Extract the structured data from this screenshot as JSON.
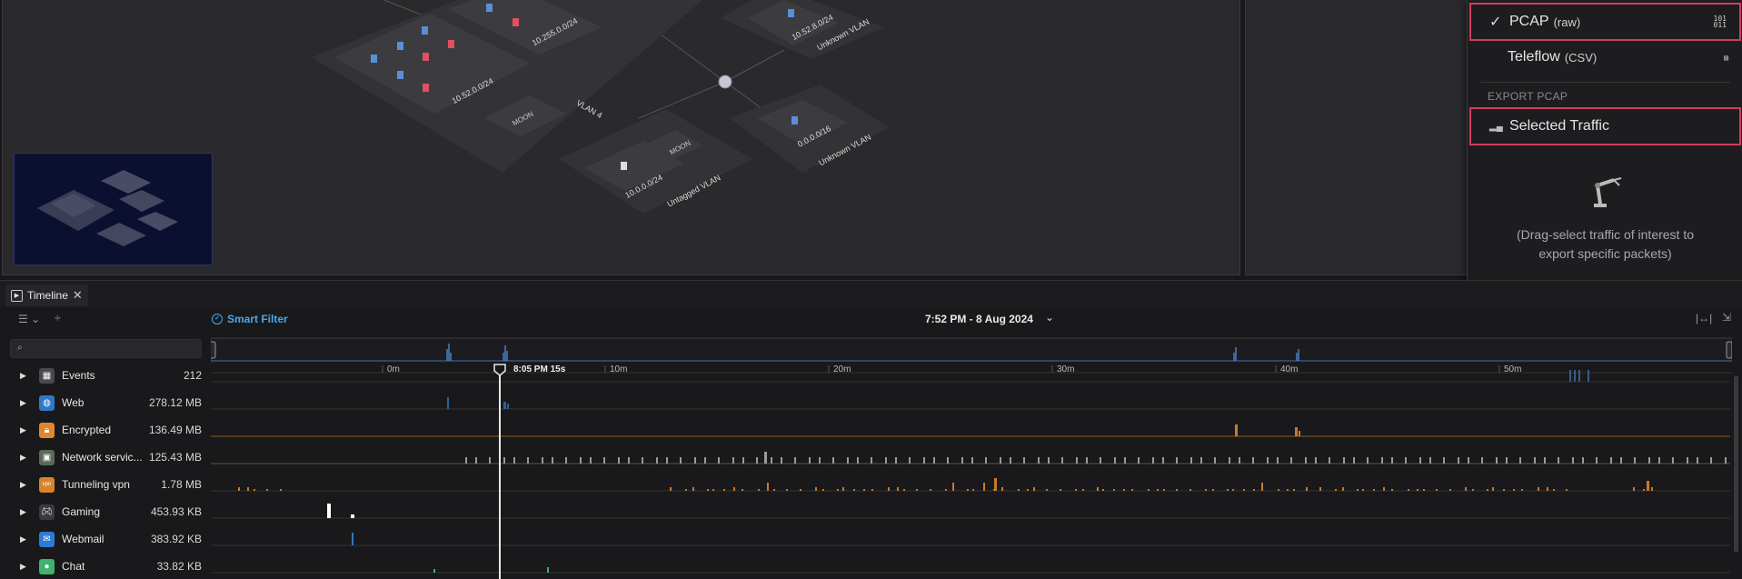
{
  "map": {
    "subnets": [
      "10.52.0.0/24",
      "10.255.0.0/24",
      "10.0.0.0/24",
      "10.52.8.0/24",
      "0.0.0.0/16",
      "10.0.0.0/24"
    ],
    "vlans": [
      "VLAN 4",
      "Unknown VLAN",
      "Unknown VLAN",
      "Untagged VLAN"
    ],
    "small_labels": [
      "MOON",
      "MOON"
    ]
  },
  "export_menu": {
    "pcap_label": "PCAP",
    "pcap_sub": "(raw)",
    "pcap_checked": true,
    "teleflow_label": "Teleflow",
    "teleflow_sub": "(CSV)",
    "section_title": "EXPORT PCAP",
    "selected_traffic_label": "Selected Traffic",
    "help_line1": "(Drag-select traffic of interest to",
    "help_line2": "export specific packets)",
    "highlight_color": "#d23c5c"
  },
  "timeline": {
    "tab_label": "Timeline",
    "smart_filter_label": "Smart Filter",
    "date_title": "7:52 PM - 8 Aug 2024",
    "search_placeholder": "",
    "cursor_label": "8:05 PM 15s",
    "ticks": [
      "0m",
      "10m",
      "20m",
      "30m",
      "40m",
      "50m"
    ],
    "rows": [
      {
        "name": "Events",
        "size": "212",
        "icon": "calendar-icon",
        "color": "#4a4a4e"
      },
      {
        "name": "Web",
        "size": "278.12 MB",
        "icon": "globe-icon",
        "color": "#2f78c9"
      },
      {
        "name": "Encrypted",
        "size": "136.49 MB",
        "icon": "lock-icon",
        "color": "#e0872e"
      },
      {
        "name": "Network servic...",
        "size": "125.43 MB",
        "icon": "network-service-icon",
        "color": "#5a6a5a"
      },
      {
        "name": "Tunneling vpn",
        "size": "1.78 MB",
        "icon": "vpn-icon",
        "color": "#d9822b"
      },
      {
        "name": "Gaming",
        "size": "453.93 KB",
        "icon": "gamepad-icon",
        "color": "#3a3a3e"
      },
      {
        "name": "Webmail",
        "size": "383.92 KB",
        "icon": "mail-icon",
        "color": "#2f7ad6"
      },
      {
        "name": "Chat",
        "size": "33.82 KB",
        "icon": "chat-icon",
        "color": "#3db36b"
      }
    ]
  }
}
